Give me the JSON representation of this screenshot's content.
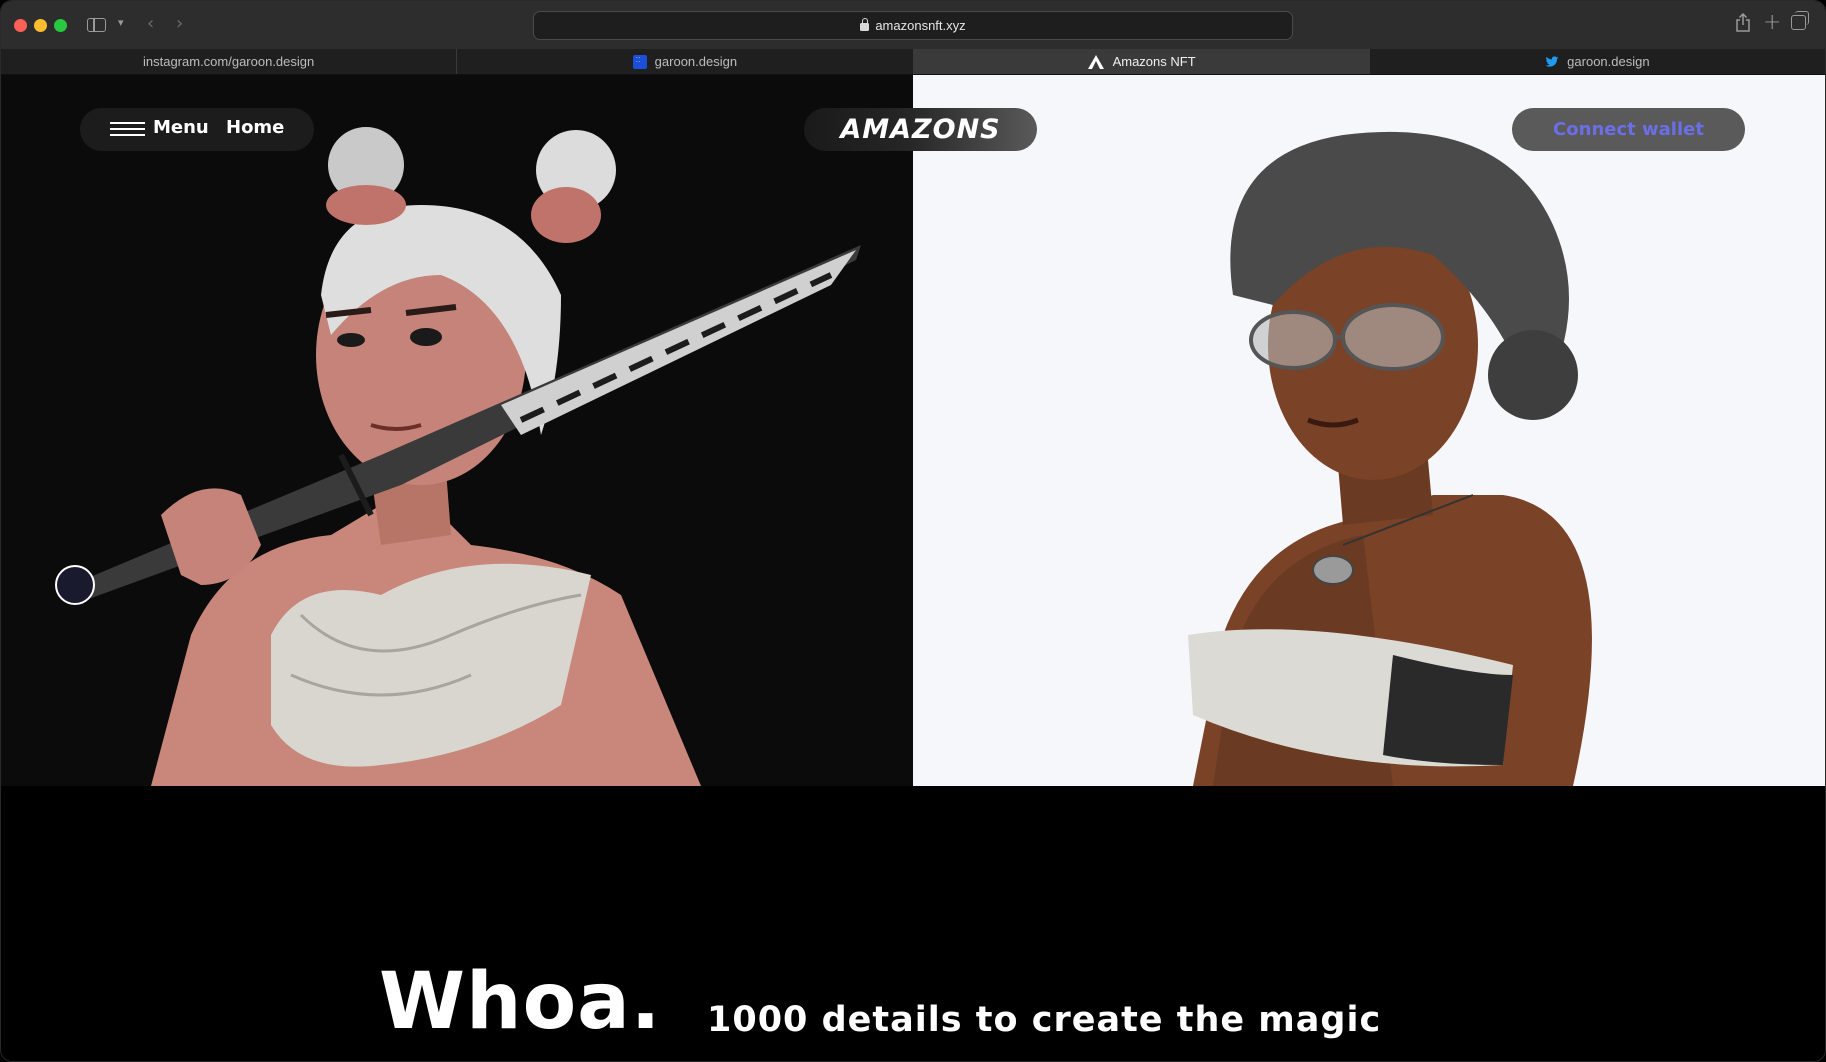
{
  "browser": {
    "url": "amazonsnft.xyz",
    "tabs": [
      {
        "label": "instagram.com/garoon.design",
        "icon": "",
        "active": false
      },
      {
        "label": "garoon.design",
        "icon": "garoon-favicon",
        "active": false
      },
      {
        "label": "Amazons NFT",
        "icon": "amazons-favicon",
        "active": true
      },
      {
        "label": "garoon.design",
        "icon": "twitter-favicon",
        "active": false
      }
    ]
  },
  "header": {
    "menu_label": "Menu",
    "home_label": "Home",
    "logo_text": "AMAZONS",
    "connect_label": "Connect wallet"
  },
  "hero": {
    "headline": "Whoa.",
    "tagline": "1000 details to create the magic"
  },
  "colors": {
    "accent": "#6a6fe8",
    "left_panel_bg": "#0b0b0b",
    "right_panel_bg": "#f6f7fa"
  }
}
